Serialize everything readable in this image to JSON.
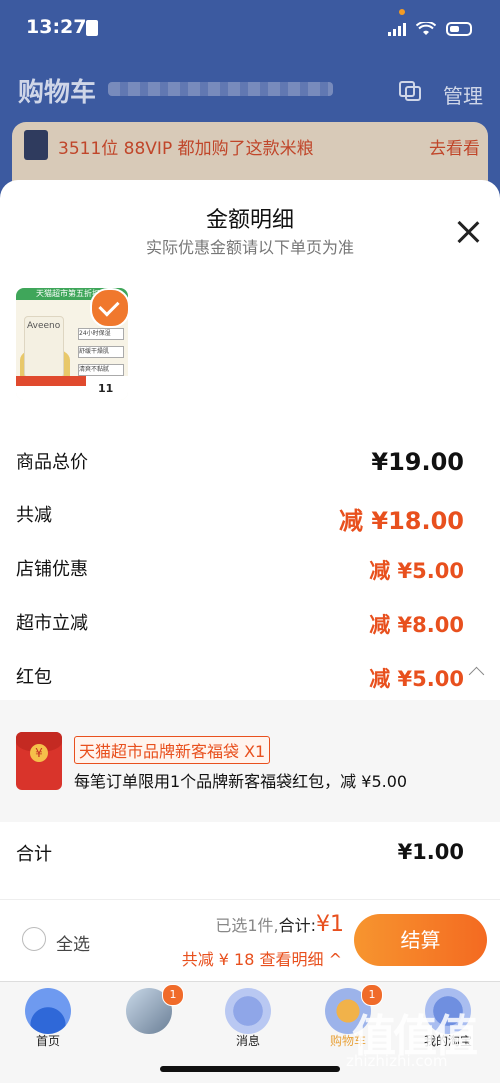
{
  "status": {
    "time": "13:27"
  },
  "header": {
    "title": "购物车",
    "manage_label": "管理"
  },
  "banner": {
    "text": "3511位 88VIP 都加购了这款米粮",
    "link": "去看看"
  },
  "sheet": {
    "title": "金额明细",
    "subtitle": "实际优惠金额请以下单页为准",
    "product": {
      "brand": "Aveeno",
      "top_text": "天猫超市第五折扣率",
      "tags": [
        "24小时保湿",
        "舒缓干燥肌",
        "清爽不黏腻"
      ],
      "price_tag": "11"
    },
    "rows": [
      {
        "label": "商品总价",
        "value": "¥19.00"
      },
      {
        "label": "共减",
        "value": "减 ¥18.00"
      },
      {
        "label": "店铺优惠",
        "value": "减 ¥5.00"
      },
      {
        "label": "超市立减",
        "value": "减 ¥8.00"
      },
      {
        "label": "红包",
        "value": "减 ¥5.00"
      }
    ],
    "redpack": {
      "tag": "天猫超市品牌新客福袋 X1",
      "desc": "每笔订单限用1个品牌新客福袋红包，减 ¥5.00"
    },
    "total": {
      "label": "合计",
      "value": "¥1.00"
    }
  },
  "footer": {
    "select_all": "全选",
    "selected_prefix": "已选1件,",
    "total_label": "合计:",
    "total_value": "¥1",
    "discount_text": "共减 ¥ 18  查看明细 ^",
    "checkout_label": "结算"
  },
  "tabs": [
    {
      "label": "首页",
      "badge": ""
    },
    {
      "label": "",
      "badge": "1"
    },
    {
      "label": "消息",
      "badge": ""
    },
    {
      "label": "购物车",
      "badge": "1"
    },
    {
      "label": "我的淘宝",
      "badge": ""
    }
  ],
  "watermark": {
    "text": "值值值",
    "url": "zhizhizhi.com"
  }
}
